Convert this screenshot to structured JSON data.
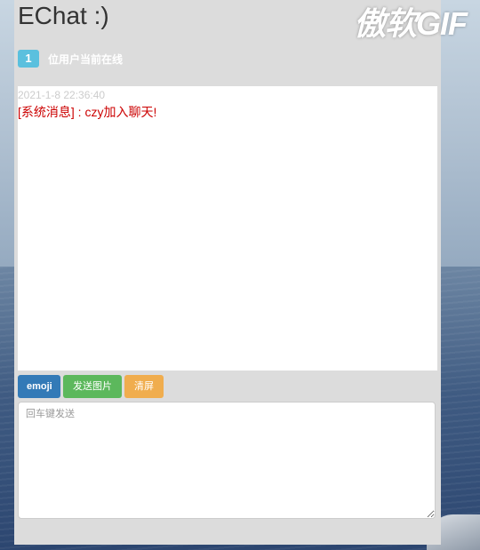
{
  "app": {
    "title": "EChat :)",
    "watermark": "傲软GIF"
  },
  "online": {
    "count": "1",
    "label": "位用户当前在线"
  },
  "messages": [
    {
      "time": "2021-1-8 22:36:40",
      "text": "[系统消息] : czy加入聊天!"
    }
  ],
  "toolbar": {
    "emoji_label": "emoji",
    "image_label": "发送图片",
    "clear_label": "清屏"
  },
  "input": {
    "placeholder": "回车键发送",
    "value": ""
  },
  "colors": {
    "panel_bg": "#dcdcdc",
    "badge": "#5bc0de",
    "emoji_button": "#337ab7",
    "image_button": "#5cb85c",
    "clear_button": "#f0ad4e",
    "system_message": "#cc0000",
    "timestamp": "#cccccc"
  }
}
